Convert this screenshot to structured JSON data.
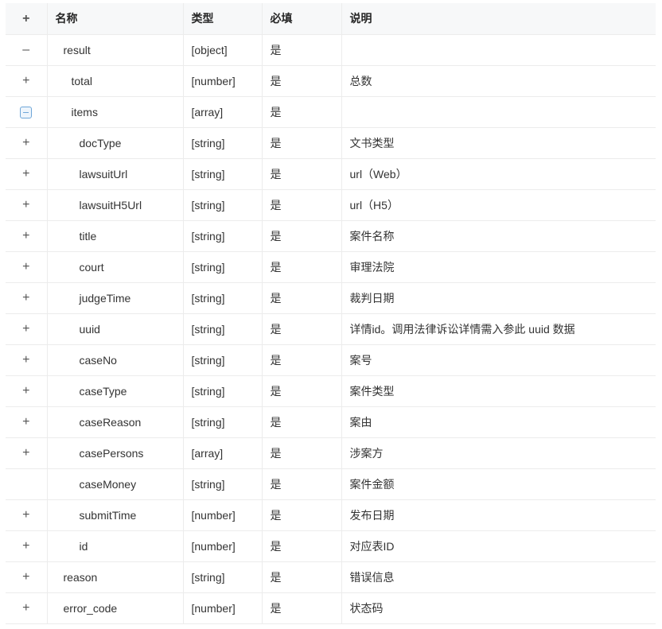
{
  "header": {
    "toggle": "+",
    "name": "名称",
    "type": "类型",
    "required": "必填",
    "desc": "说明"
  },
  "rows": [
    {
      "toggle": "–",
      "toggle_style": "plain",
      "name": "result",
      "level": 0,
      "type": "[object]",
      "required": "是",
      "desc": ""
    },
    {
      "toggle": "+",
      "toggle_style": "plain",
      "name": "total",
      "level": 1,
      "type": "[number]",
      "required": "是",
      "desc": "总数"
    },
    {
      "toggle": "",
      "toggle_style": "boxed-minus",
      "name": "items",
      "level": 1,
      "type": "[array]",
      "required": "是",
      "desc": ""
    },
    {
      "toggle": "+",
      "toggle_style": "plain",
      "name": "docType",
      "level": 2,
      "type": "[string]",
      "required": "是",
      "desc": "文书类型"
    },
    {
      "toggle": "+",
      "toggle_style": "plain",
      "name": "lawsuitUrl",
      "level": 2,
      "type": "[string]",
      "required": "是",
      "desc": "url（Web）"
    },
    {
      "toggle": "+",
      "toggle_style": "plain",
      "name": "lawsuitH5Url",
      "level": 2,
      "type": "[string]",
      "required": "是",
      "desc": "url（H5）"
    },
    {
      "toggle": "+",
      "toggle_style": "plain",
      "name": "title",
      "level": 2,
      "type": "[string]",
      "required": "是",
      "desc": "案件名称"
    },
    {
      "toggle": "+",
      "toggle_style": "plain",
      "name": "court",
      "level": 2,
      "type": "[string]",
      "required": "是",
      "desc": "审理法院"
    },
    {
      "toggle": "+",
      "toggle_style": "plain",
      "name": "judgeTime",
      "level": 2,
      "type": "[string]",
      "required": "是",
      "desc": "裁判日期"
    },
    {
      "toggle": "+",
      "toggle_style": "plain",
      "name": "uuid",
      "level": 2,
      "type": "[string]",
      "required": "是",
      "desc": "详情id。调用法律诉讼详情需入参此 uuid 数据"
    },
    {
      "toggle": "+",
      "toggle_style": "plain",
      "name": "caseNo",
      "level": 2,
      "type": "[string]",
      "required": "是",
      "desc": "案号"
    },
    {
      "toggle": "+",
      "toggle_style": "plain",
      "name": "caseType",
      "level": 2,
      "type": "[string]",
      "required": "是",
      "desc": "案件类型"
    },
    {
      "toggle": "+",
      "toggle_style": "plain",
      "name": "caseReason",
      "level": 2,
      "type": "[string]",
      "required": "是",
      "desc": "案由"
    },
    {
      "toggle": "+",
      "toggle_style": "plain",
      "name": "casePersons",
      "level": 2,
      "type": "[array]",
      "required": "是",
      "desc": "涉案方"
    },
    {
      "toggle": "",
      "toggle_style": "none",
      "name": "caseMoney",
      "level": 2,
      "type": "[string]",
      "required": "是",
      "desc": "案件金额"
    },
    {
      "toggle": "+",
      "toggle_style": "plain",
      "name": "submitTime",
      "level": 2,
      "type": "[number]",
      "required": "是",
      "desc": "发布日期"
    },
    {
      "toggle": "+",
      "toggle_style": "plain",
      "name": "id",
      "level": 2,
      "type": "[number]",
      "required": "是",
      "desc": "对应表ID"
    },
    {
      "toggle": "+",
      "toggle_style": "plain",
      "name": "reason",
      "level": 0,
      "type": "[string]",
      "required": "是",
      "desc": "错误信息"
    },
    {
      "toggle": "+",
      "toggle_style": "plain",
      "name": "error_code",
      "level": 0,
      "type": "[number]",
      "required": "是",
      "desc": "状态码"
    }
  ]
}
